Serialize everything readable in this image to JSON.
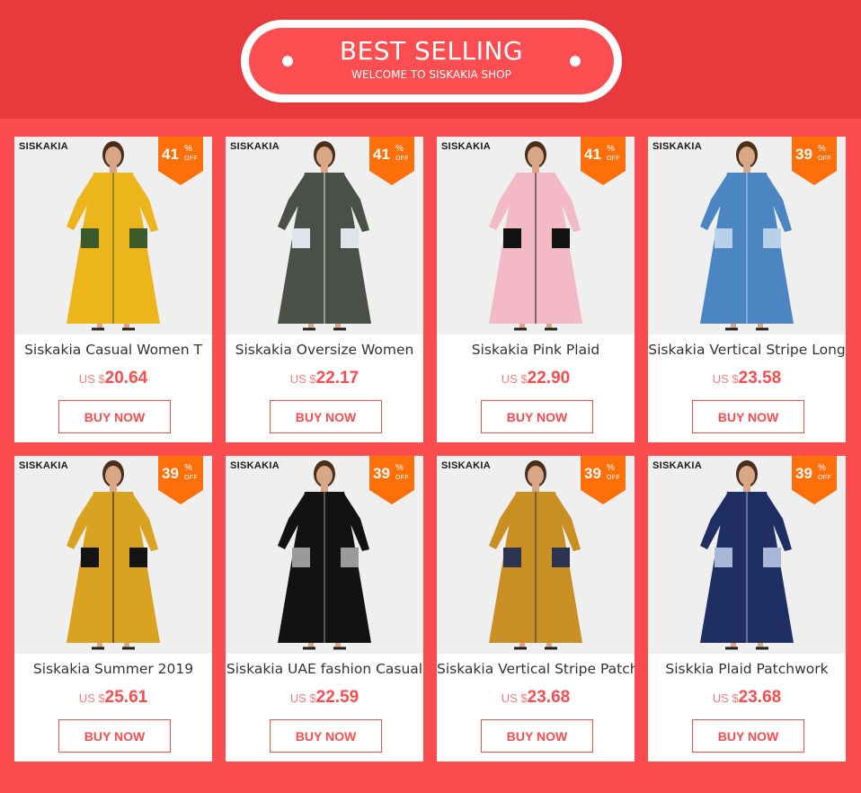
{
  "header": {
    "title": "BEST SELLING",
    "subtitle": "WELCOME TO SISKAKIA SHOP",
    "background": "#e8393d"
  },
  "colors": {
    "page_bg": "#fb4d4f",
    "accent": "#fb4d4f",
    "badge": "#fe6f0a"
  },
  "products": [
    {
      "brand": "SISKAKIA",
      "discount": "41",
      "pct": "%",
      "off": "OFF",
      "title": "Siskakia Casual Women T",
      "currency": "US $",
      "price": "20.64",
      "button": "BUY NOW",
      "dress": "#ecb51c",
      "accent": "#3c5a2a"
    },
    {
      "brand": "SISKAKIA",
      "discount": "41",
      "pct": "%",
      "off": "OFF",
      "title": "Siskakia Oversize Women",
      "currency": "US $",
      "price": "22.17",
      "button": "BUY NOW",
      "dress": "#4a4f48",
      "accent": "#dfe3ea"
    },
    {
      "brand": "SISKAKIA",
      "discount": "41",
      "pct": "%",
      "off": "OFF",
      "title": "Siskakia Pink Plaid",
      "currency": "US $",
      "price": "22.90",
      "button": "BUY NOW",
      "dress": "#f3b9c6",
      "accent": "#111111"
    },
    {
      "brand": "SISKAKIA",
      "discount": "39",
      "pct": "%",
      "off": "OFF",
      "title": "Siskakia Vertical Stripe Long",
      "currency": "US $",
      "price": "23.58",
      "button": "BUY NOW",
      "dress": "#4b86c2",
      "accent": "#b8d0ea"
    },
    {
      "brand": "SISKAKIA",
      "discount": "39",
      "pct": "%",
      "off": "OFF",
      "title": "Siskakia Summer 2019",
      "currency": "US $",
      "price": "25.61",
      "button": "BUY NOW",
      "dress": "#d9a220",
      "accent": "#141414"
    },
    {
      "brand": "SISKAKIA",
      "discount": "39",
      "pct": "%",
      "off": "OFF",
      "title": "Siskakia UAE fashion Casual",
      "currency": "US $",
      "price": "22.59",
      "button": "BUY NOW",
      "dress": "#121212",
      "accent": "#9a9a9a"
    },
    {
      "brand": "SISKAKIA",
      "discount": "39",
      "pct": "%",
      "off": "OFF",
      "title": "Siskakia Vertical Stripe Patch",
      "currency": "US $",
      "price": "23.68",
      "button": "BUY NOW",
      "dress": "#c98f22",
      "accent": "#2c3350"
    },
    {
      "brand": "SISKAKIA",
      "discount": "39",
      "pct": "%",
      "off": "OFF",
      "title": "Siskkia Plaid Patchwork",
      "currency": "US $",
      "price": "23.68",
      "button": "BUY NOW",
      "dress": "#1f2f63",
      "accent": "#a7b7d8"
    }
  ]
}
